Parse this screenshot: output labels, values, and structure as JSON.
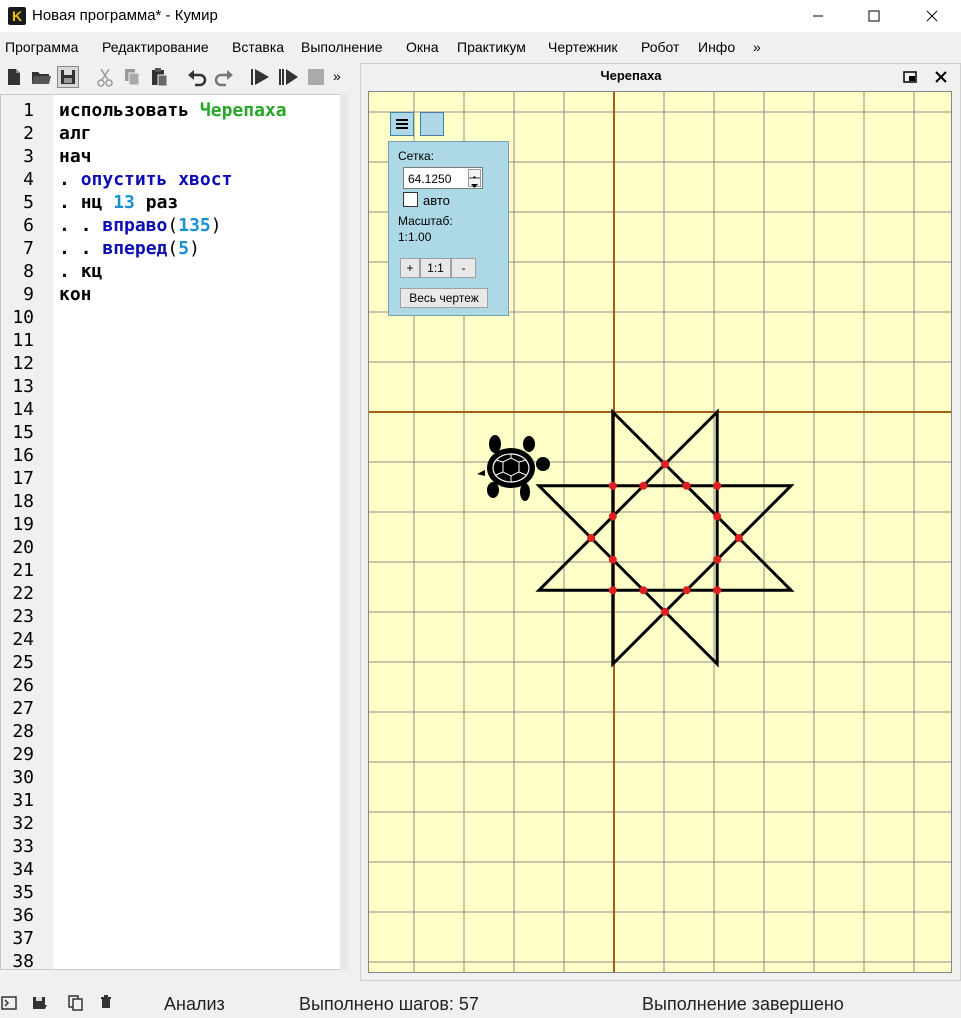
{
  "window": {
    "title": "Новая программа* - Кумир",
    "logo_letter": "K"
  },
  "menu": [
    "Программа",
    "Редактирование",
    "Вставка",
    "Выполнение",
    "Окна",
    "Практикум",
    "Чертежник",
    "Робот",
    "Инфо",
    "»"
  ],
  "toolbar": {
    "more": "»",
    "icons": [
      "new-file-icon",
      "open-folder-icon",
      "save-icon",
      "cut-icon",
      "copy-icon",
      "paste-icon",
      "undo-icon",
      "redo-icon",
      "run-icon",
      "step-icon",
      "stop-icon"
    ]
  },
  "editor": {
    "line_numbers": [
      "1",
      "2",
      "3",
      "4",
      "5",
      "6",
      "7",
      "8",
      "9",
      "10",
      "11",
      "12",
      "13",
      "14",
      "15",
      "16",
      "17",
      "18",
      "19",
      "20",
      "21",
      "22",
      "23",
      "24",
      "25",
      "26",
      "27",
      "28",
      "29",
      "30",
      "31",
      "32",
      "33",
      "34",
      "35",
      "36",
      "37",
      "38"
    ],
    "code": {
      "l1_kw": "использовать",
      "l1_mod": "Черепаха",
      "l2": "алг",
      "l3": "нач",
      "l4_dot": ".",
      "l4_cmd": "опустить хвост",
      "l5_dot": ".",
      "l5_kw": "нц",
      "l5_num": "13",
      "l5_kw2": "раз",
      "l6_dots": ". .",
      "l6_cmd": "вправо",
      "l6_num": "135",
      "l7_dots": ". .",
      "l7_cmd": "вперед",
      "l7_num": "5",
      "l8_dot": ".",
      "l8_kw": "кц",
      "l9": "кон",
      "open_paren": "(",
      "close_paren": ")"
    }
  },
  "turtle_window": {
    "title": "Черепаха",
    "grid_panel": {
      "grid_label": "Сетка:",
      "grid_value": "64.1250",
      "auto_label": "авто",
      "auto_checked": false,
      "scale_label": "Масштаб:",
      "scale_value": "1:1.00",
      "zoom_in": "+",
      "zoom_reset": "1:1",
      "zoom_out": "-",
      "fit_all": "Весь чертеж"
    },
    "colors": {
      "canvas": "#ffffc8",
      "grid": "#8c8c8c",
      "axes": "#a0601a",
      "path": "#000000",
      "intersections": "#e02020",
      "panel": "#add8e6"
    }
  },
  "status": {
    "analysis": "Анализ",
    "steps": "Выполнено шагов: 57",
    "state": "Выполнение завершено",
    "icons": [
      "console-icon",
      "save-output-icon",
      "copy-output-icon",
      "clear-output-icon"
    ]
  }
}
